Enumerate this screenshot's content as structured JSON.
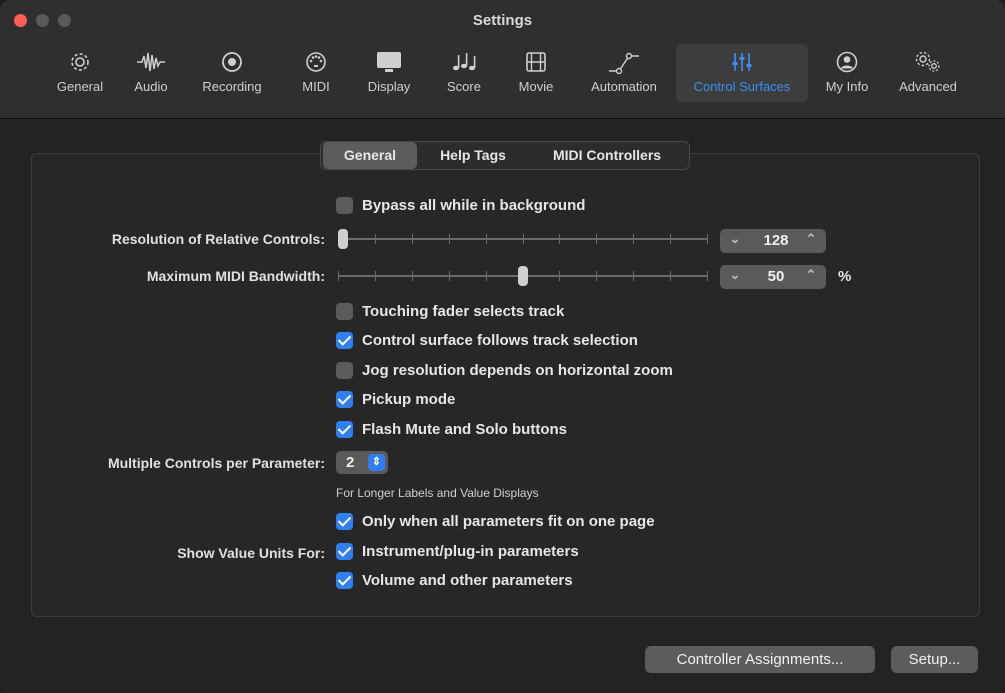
{
  "window": {
    "title": "Settings"
  },
  "toolbar": [
    {
      "label": "General",
      "icon": "gear-icon"
    },
    {
      "label": "Audio",
      "icon": "waveform-icon"
    },
    {
      "label": "Recording",
      "icon": "record-icon"
    },
    {
      "label": "MIDI",
      "icon": "midi-port-icon"
    },
    {
      "label": "Display",
      "icon": "monitor-icon"
    },
    {
      "label": "Score",
      "icon": "music-notes-icon"
    },
    {
      "label": "Movie",
      "icon": "film-icon"
    },
    {
      "label": "Automation",
      "icon": "automation-curve-icon"
    },
    {
      "label": "Control Surfaces",
      "icon": "sliders-icon",
      "active": true
    },
    {
      "label": "My Info",
      "icon": "person-icon"
    },
    {
      "label": "Advanced",
      "icon": "gears-icon"
    }
  ],
  "tabs": [
    {
      "label": "General",
      "active": true
    },
    {
      "label": "Help Tags"
    },
    {
      "label": "MIDI Controllers"
    }
  ],
  "settings": {
    "bypass_background": {
      "label": "Bypass all while in background",
      "checked": false
    },
    "resolution": {
      "label": "Resolution of Relative Controls:",
      "value": "128",
      "slider_fraction": 0.0
    },
    "bandwidth": {
      "label": "Maximum MIDI Bandwidth:",
      "value": "50",
      "unit": "%",
      "slider_fraction": 0.5
    },
    "touching_fader": {
      "label": "Touching fader selects track",
      "checked": false
    },
    "follows_selection": {
      "label": "Control surface follows track selection",
      "checked": true
    },
    "jog_resolution": {
      "label": "Jog resolution depends on horizontal zoom",
      "checked": false
    },
    "pickup_mode": {
      "label": "Pickup mode",
      "checked": true
    },
    "flash_mute_solo": {
      "label": "Flash Mute and Solo buttons",
      "checked": true
    },
    "multiple_controls": {
      "label": "Multiple Controls per Parameter:",
      "value": "2"
    },
    "longer_labels_note": "For Longer Labels and Value Displays",
    "only_one_page": {
      "label": "Only when all parameters fit on one page",
      "checked": true
    },
    "value_units_label": "Show Value Units For:",
    "units_instrument": {
      "label": "Instrument/plug-in parameters",
      "checked": true
    },
    "units_volume": {
      "label": "Volume and other parameters",
      "checked": true
    }
  },
  "buttons": {
    "controller_assignments": "Controller Assignments...",
    "setup": "Setup..."
  },
  "colors": {
    "accent": "#2f7ff0",
    "active_toolbar": "#3b8ff7",
    "close": "#ff5f57"
  }
}
